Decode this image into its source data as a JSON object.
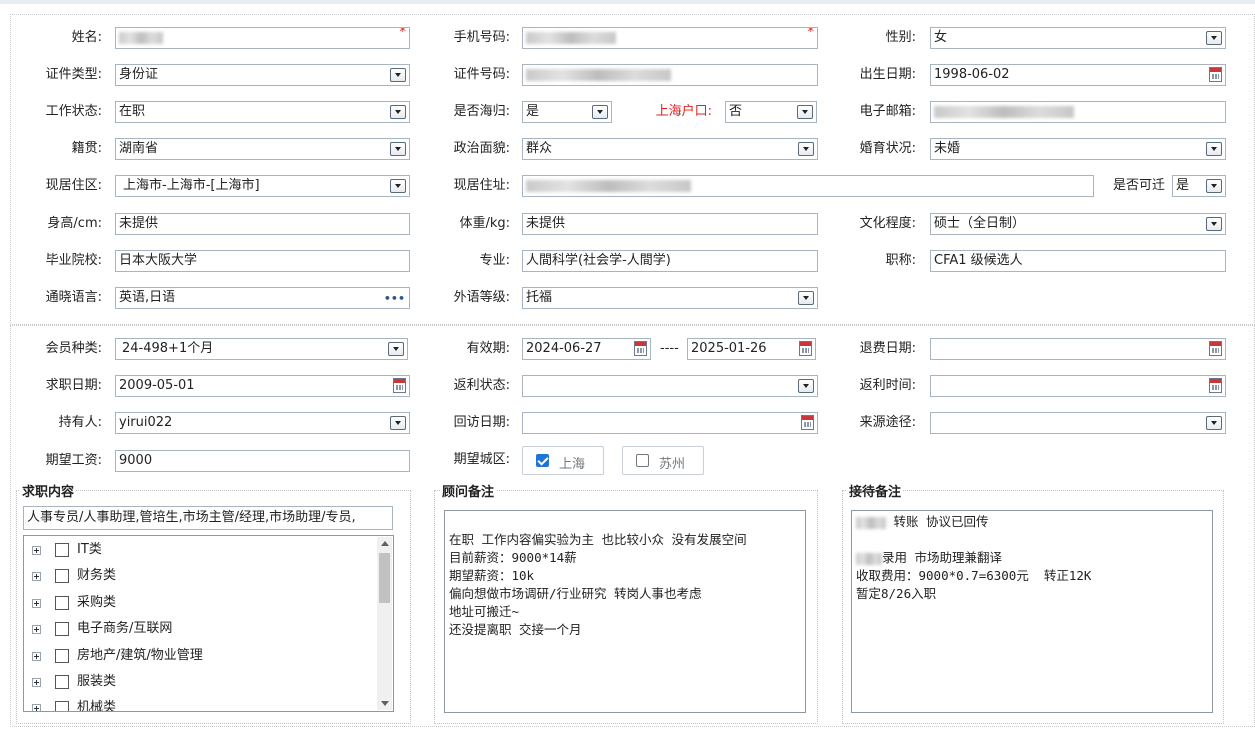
{
  "form": {
    "name": {
      "label": "姓名:"
    },
    "phone": {
      "label": "手机号码:"
    },
    "gender": {
      "label": "性别:",
      "value": "女"
    },
    "id_type": {
      "label": "证件类型:",
      "value": "身份证"
    },
    "id_number": {
      "label": "证件号码:"
    },
    "birth_date": {
      "label": "出生日期:",
      "value": "1998-06-02"
    },
    "work_status": {
      "label": "工作状态:",
      "value": "在职"
    },
    "overseas_return": {
      "label": "是否海归:",
      "value": "是"
    },
    "shanghai_hukou": {
      "label": "上海户口:",
      "value": "否"
    },
    "email": {
      "label": "电子邮箱:"
    },
    "native_place": {
      "label": "籍贯:",
      "value": "湖南省"
    },
    "political_status": {
      "label": "政治面貌:",
      "value": "群众"
    },
    "marital_status": {
      "label": "婚育状况:",
      "value": "未婚"
    },
    "residence_area": {
      "label": "现居住区:",
      "value": "上海市-上海市-[上海市]"
    },
    "residence_address": {
      "label": "现居住址:"
    },
    "relocatable": {
      "label": "是否可迁",
      "value": "是"
    },
    "height": {
      "label": "身高/cm:",
      "value": "未提供"
    },
    "weight": {
      "label": "体重/kg:",
      "value": "未提供"
    },
    "education": {
      "label": "文化程度:",
      "value": "硕士（全日制）"
    },
    "school": {
      "label": "毕业院校:",
      "value": "日本大阪大学"
    },
    "major": {
      "label": "专业:",
      "value": "人間科学(社会学-人間学)"
    },
    "title": {
      "label": "职称:",
      "value": "CFA1 级候选人"
    },
    "languages": {
      "label": "通晓语言:",
      "value": "英语,日语"
    },
    "language_level": {
      "label": "外语等级:",
      "value": "托福"
    }
  },
  "membership": {
    "member_type": {
      "label": "会员种类:",
      "value": "24-498+1个月"
    },
    "valid_period": {
      "label": "有效期:",
      "start": "2024-06-27",
      "separator": "----",
      "end": "2025-01-26"
    },
    "refund_date": {
      "label": "退费日期:",
      "value": ""
    },
    "job_seek_date": {
      "label": "求职日期:",
      "value": "2009-05-01"
    },
    "rebate_status": {
      "label": "返利状态:",
      "value": ""
    },
    "rebate_time": {
      "label": "返利时间:",
      "value": ""
    },
    "holder": {
      "label": "持有人:",
      "value": "yirui022"
    },
    "revisit_date": {
      "label": "回访日期:",
      "value": ""
    },
    "source": {
      "label": "来源途径:",
      "value": ""
    },
    "expected_salary": {
      "label": "期望工资:",
      "value": "9000"
    },
    "expected_city": {
      "label": "期望城区:",
      "options": [
        {
          "label": "上海",
          "checked": true
        },
        {
          "label": "苏州",
          "checked": false
        }
      ]
    }
  },
  "job_content": {
    "title": "求职内容",
    "summary": "人事专员/人事助理,管培生,市场主管/经理,市场助理/专员,",
    "tree": [
      "IT类",
      "财务类",
      "采购类",
      "电子商务/互联网",
      "房地产/建筑/物业管理",
      "服装类",
      "机械类"
    ]
  },
  "consultant_notes": {
    "title": "顾问备注",
    "lines": [
      "",
      "在职 工作内容偏实验为主 也比较小众 没有发展空间",
      "目前薪资：9000*14薪",
      "期望薪资：10k",
      "偏向想做市场调研/行业研究 转岗人事也考虑",
      "地址可搬迁~",
      "还没提离职 交接一个月"
    ]
  },
  "reception_notes": {
    "title": "接待备注",
    "line1_suffix": " 转账 协议已回传",
    "line2": "",
    "line3_suffix": "录用 市场助理兼翻译",
    "line4": "收取费用：9000*0.7=6300元  转正12K",
    "line5": "暂定8/26入职"
  },
  "required_mark": "*"
}
